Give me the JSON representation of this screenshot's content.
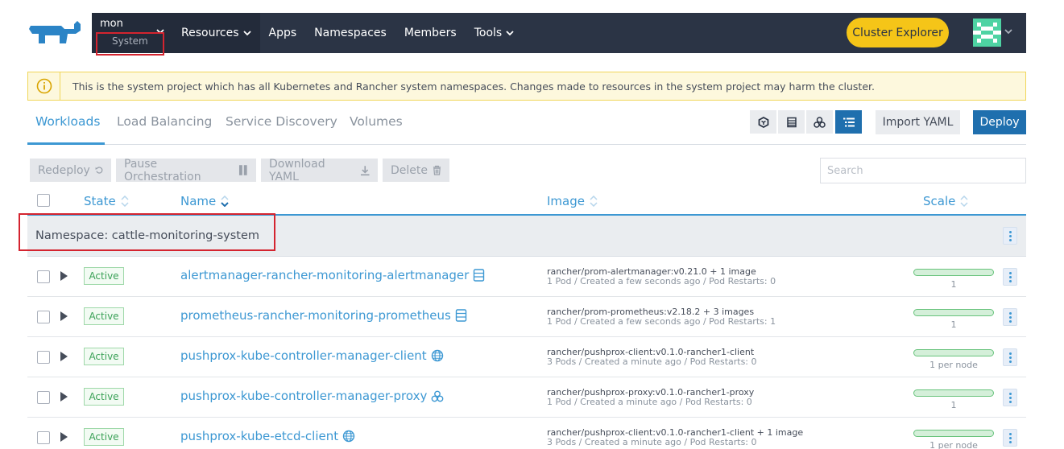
{
  "header": {
    "cluster_name": "mon",
    "project_name": "System",
    "nav": [
      "Resources",
      "Apps",
      "Namespaces",
      "Members",
      "Tools"
    ],
    "cluster_explorer": "Cluster Explorer"
  },
  "banner": {
    "text": "This is the system project which has all Kubernetes and Rancher system namespaces. Changes made to resources in the system project may harm the cluster."
  },
  "tabs": [
    "Workloads",
    "Load Balancing",
    "Service Discovery",
    "Volumes"
  ],
  "toolbar": {
    "import_yaml": "Import YAML",
    "deploy": "Deploy"
  },
  "bulk_actions": {
    "redeploy": "Redeploy",
    "pause": "Pause Orchestration",
    "download": "Download YAML",
    "delete": "Delete"
  },
  "search": {
    "placeholder": "Search"
  },
  "table": {
    "columns": [
      "State",
      "Name",
      "Image",
      "Scale"
    ],
    "namespace_group": "Namespace: cattle-monitoring-system",
    "rows": [
      {
        "state": "Active",
        "name": "alertmanager-rancher-monitoring-alertmanager",
        "type_icon": "statefulset-icon",
        "image": "rancher/prom-alertmanager:v0.21.0 + 1 image",
        "details": "1 Pod / Created a few seconds ago / Pod Restarts: 0",
        "scale": "1"
      },
      {
        "state": "Active",
        "name": "prometheus-rancher-monitoring-prometheus",
        "type_icon": "statefulset-icon",
        "image": "rancher/prom-prometheus:v2.18.2 + 3 images",
        "details": "1 Pod / Created a few seconds ago / Pod Restarts: 1",
        "scale": "1"
      },
      {
        "state": "Active",
        "name": "pushprox-kube-controller-manager-client",
        "type_icon": "daemonset-icon",
        "image": "rancher/pushprox-client:v0.1.0-rancher1-client",
        "details": "3 Pods / Created a minute ago / Pod Restarts: 0",
        "scale": "1 per node"
      },
      {
        "state": "Active",
        "name": "pushprox-kube-controller-manager-proxy",
        "type_icon": "deployment-icon",
        "image": "rancher/pushprox-proxy:v0.1.0-rancher1-proxy",
        "details": "1 Pod / Created a minute ago / Pod Restarts: 0",
        "scale": "1"
      },
      {
        "state": "Active",
        "name": "pushprox-kube-etcd-client",
        "type_icon": "daemonset-icon",
        "image": "rancher/pushprox-client:v0.1.0-rancher1-client + 1 image",
        "details": "3 Pods / Created a minute ago / Pod Restarts: 0",
        "scale": "1 per node"
      }
    ]
  },
  "colors": {
    "accent": "#3d98d3",
    "nav_bg": "#2b3445",
    "cluster_explorer": "#f5c518",
    "highlight_box": "#d4242f",
    "active_badge": "#3aa157"
  }
}
